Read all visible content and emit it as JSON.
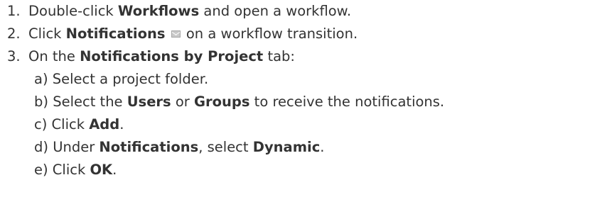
{
  "steps": [
    {
      "number": "1.",
      "pre": "Double-click ",
      "bold": "Workflows",
      "post": " and open a workflow."
    },
    {
      "number": "2.",
      "pre": "Click ",
      "bold": "Notifications",
      "icon": "mail-icon",
      "post": " on a workflow transition."
    },
    {
      "number": "3.",
      "pre": "On the ",
      "bold": "Notifications by Project",
      "post": " tab:"
    }
  ],
  "substeps": [
    {
      "letter": "a)",
      "text": " Select a project folder."
    },
    {
      "letter": "b)",
      "pre": " Select the ",
      "bold1": "Users",
      "mid": " or ",
      "bold2": "Groups",
      "post": " to receive the notifications."
    },
    {
      "letter": "c)",
      "pre": " Click ",
      "bold": "Add",
      "post": "."
    },
    {
      "letter": "d)",
      "pre": " Under ",
      "bold1": "Notifications",
      "mid": ", select ",
      "bold2": "Dynamic",
      "post": "."
    },
    {
      "letter": "e)",
      "pre": " Click ",
      "bold": "OK",
      "post": "."
    }
  ]
}
